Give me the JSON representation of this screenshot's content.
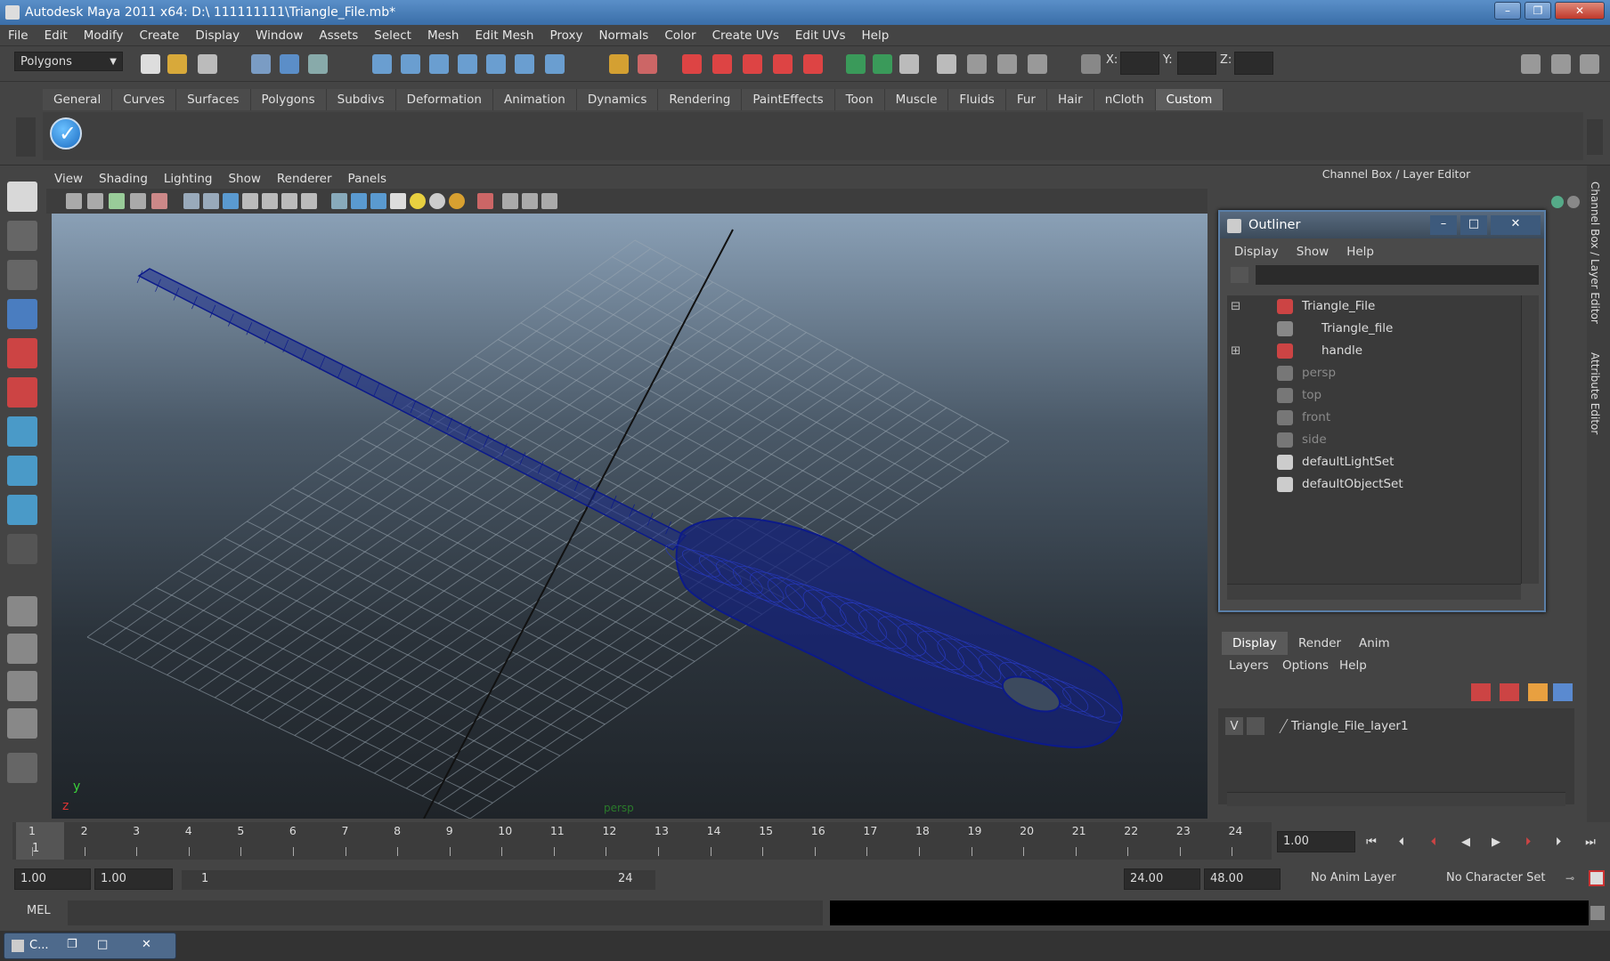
{
  "window": {
    "title": "Autodesk Maya 2011 x64: D:\\ 111111111\\Triangle_File.mb*",
    "minimize": "–",
    "restore": "❐",
    "close": "✕"
  },
  "menubar": [
    "File",
    "Edit",
    "Modify",
    "Create",
    "Display",
    "Window",
    "Assets",
    "Select",
    "Mesh",
    "Edit Mesh",
    "Proxy",
    "Normals",
    "Color",
    "Create UVs",
    "Edit UVs",
    "Help"
  ],
  "statusline": {
    "mode": "Polygons",
    "x_label": "X:",
    "y_label": "Y:",
    "z_label": "Z:"
  },
  "shelf": {
    "tabs": [
      "General",
      "Curves",
      "Surfaces",
      "Polygons",
      "Subdivs",
      "Deformation",
      "Animation",
      "Dynamics",
      "Rendering",
      "PaintEffects",
      "Toon",
      "Muscle",
      "Fluids",
      "Fur",
      "Hair",
      "nCloth",
      "Custom"
    ],
    "active_tab": "Custom"
  },
  "panel_menu": [
    "View",
    "Shading",
    "Lighting",
    "Show",
    "Renderer",
    "Panels"
  ],
  "viewport": {
    "axis_y": "y",
    "axis_z": "z",
    "camera_label": "persp"
  },
  "channel_box": {
    "title": "Channel Box / Layer Editor"
  },
  "outliner": {
    "title": "Outliner",
    "menu": [
      "Display",
      "Show",
      "Help"
    ],
    "items": [
      {
        "label": "Triangle_File",
        "indent": 0,
        "dim": false,
        "expander": "⊟"
      },
      {
        "label": "Triangle_file",
        "indent": 1,
        "dim": false,
        "expander": ""
      },
      {
        "label": "handle",
        "indent": 1,
        "dim": false,
        "expander": "⊞"
      },
      {
        "label": "persp",
        "indent": 0,
        "dim": true,
        "expander": ""
      },
      {
        "label": "top",
        "indent": 0,
        "dim": true,
        "expander": ""
      },
      {
        "label": "front",
        "indent": 0,
        "dim": true,
        "expander": ""
      },
      {
        "label": "side",
        "indent": 0,
        "dim": true,
        "expander": ""
      },
      {
        "label": "defaultLightSet",
        "indent": 0,
        "dim": false,
        "expander": ""
      },
      {
        "label": "defaultObjectSet",
        "indent": 0,
        "dim": false,
        "expander": ""
      }
    ]
  },
  "layer_editor": {
    "tabs": [
      "Display",
      "Render",
      "Anim"
    ],
    "active_tab": "Display",
    "menu": [
      "Layers",
      "Options",
      "Help"
    ],
    "layer": {
      "visibility": "V",
      "name": "Triangle_File_layer1"
    }
  },
  "side_tabs": [
    "Channel Box / Layer Editor",
    "Attribute Editor"
  ],
  "timeline": {
    "frames": [
      "1",
      "2",
      "3",
      "4",
      "5",
      "6",
      "7",
      "8",
      "9",
      "10",
      "11",
      "12",
      "13",
      "14",
      "15",
      "16",
      "17",
      "18",
      "19",
      "20",
      "21",
      "22",
      "23",
      "24"
    ],
    "current_marker": "1",
    "current_frame": "1.00"
  },
  "range": {
    "start": "1.00",
    "start2": "1.00",
    "range_start": "1",
    "range_end": "24",
    "end": "24.00",
    "end2": "48.00",
    "anim_layer": "No Anim Layer",
    "character_set": "No Character Set"
  },
  "cmdline": {
    "label": "MEL"
  },
  "taskbar": {
    "item": "C..."
  }
}
